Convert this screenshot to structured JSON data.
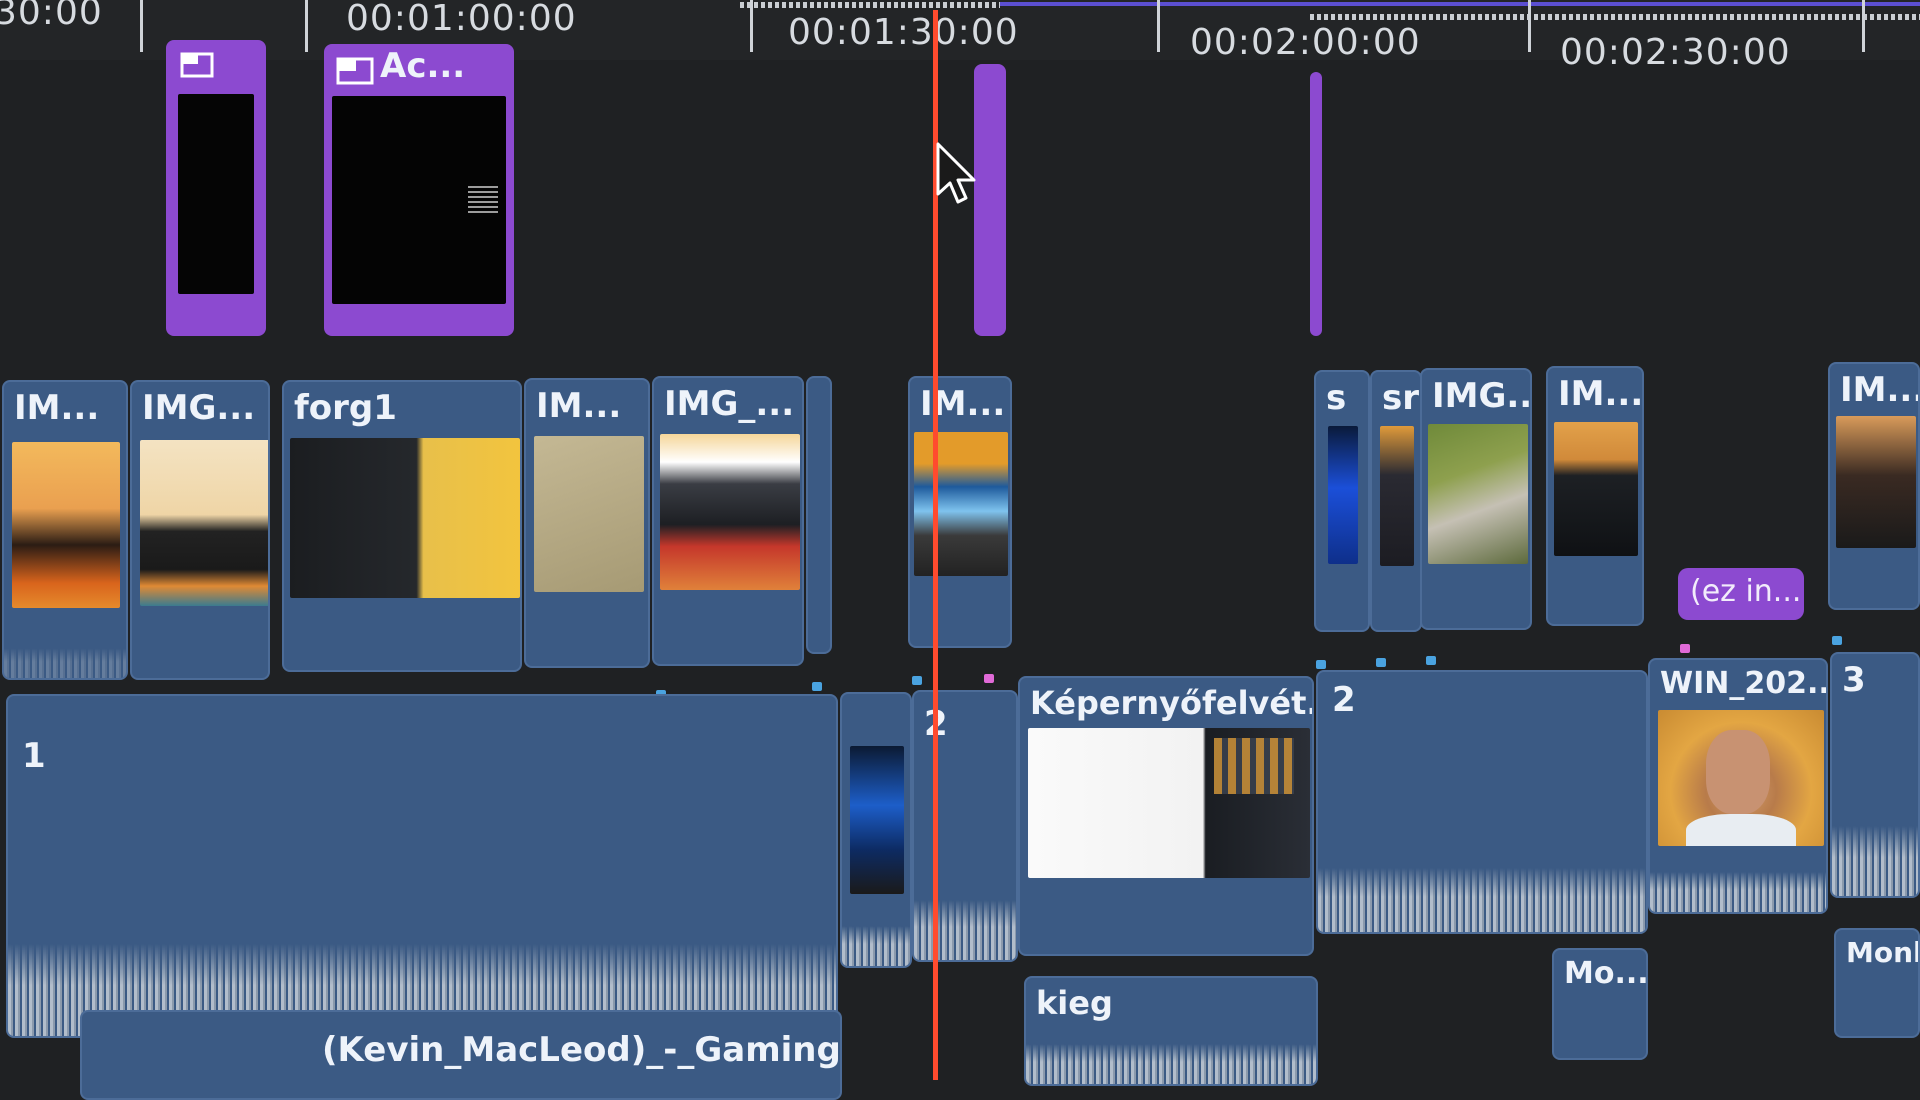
{
  "ruler": {
    "timecodes": [
      "30:00",
      "00:01:00:00",
      "00:01:30:00",
      "00:02:00:00",
      "00:02:30:00"
    ]
  },
  "connected_clips": {
    "clip_b_label": "Ac...",
    "title_chip_label": "(ez in..."
  },
  "broll": {
    "clips": [
      "IM...",
      "IMG...",
      "forg1",
      "IM...",
      "IMG_...",
      "IM...",
      "s",
      "sr",
      "IMG...",
      "IM...",
      "IM..."
    ]
  },
  "primary": {
    "clip1": "1",
    "clip2": "2",
    "screen_rec": "Képernyőfelvét...",
    "clip2b": "2",
    "win": "WIN_202...",
    "clip3": "3"
  },
  "audio": {
    "music": "(Kevin_MacLeod)_-_Gaming_Ba...",
    "kieg": "kieg",
    "mo": "Mo...",
    "monke": "Monke"
  },
  "colors": {
    "clip_blue": "#3b5a84",
    "clip_purple": "#8c4ad0",
    "playhead": "#ff4b2e",
    "background": "#1f2123"
  }
}
